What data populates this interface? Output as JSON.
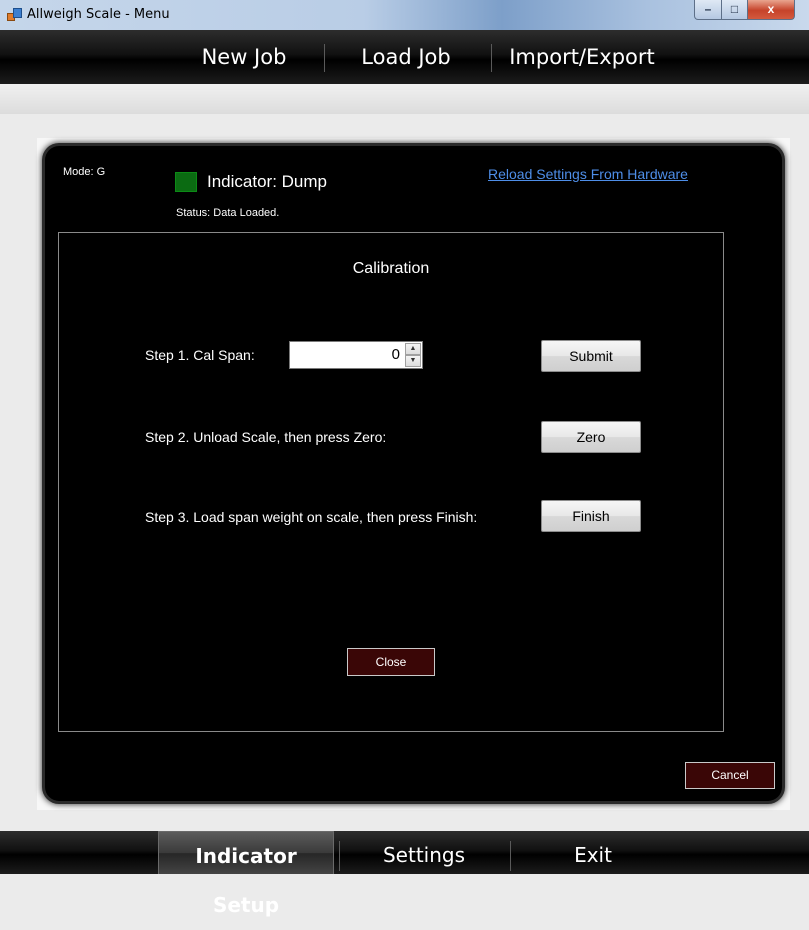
{
  "window": {
    "title": "Allweigh Scale - Menu",
    "controls": {
      "minimize": "–",
      "maximize": "□",
      "close": "x"
    }
  },
  "top_menu": {
    "items": [
      {
        "label": "New Job"
      },
      {
        "label": "Load Job"
      },
      {
        "label": "Import/Export"
      }
    ]
  },
  "header": {
    "mode": "Mode: G",
    "indicator_label": "Indicator: Dump",
    "indicator_color": "#0b6b12",
    "status": "Status: Data Loaded.",
    "reload_link": "Reload Settings From Hardware"
  },
  "calibration": {
    "title": "Calibration",
    "step1_label": "Step 1.  Cal Span:",
    "cal_span_value": "0",
    "submit_label": "Submit",
    "step2_label": "Step 2.  Unload Scale, then press Zero:",
    "zero_label": "Zero",
    "step3_label": "Step 3.  Load span weight on scale, then press Finish:",
    "finish_label": "Finish",
    "close_label": "Close"
  },
  "footer": {
    "cancel_label": "Cancel"
  },
  "bottom_menu": {
    "items": [
      {
        "label": "Indicator Setup",
        "active": true
      },
      {
        "label": "Settings",
        "active": false
      },
      {
        "label": "Exit",
        "active": false
      }
    ]
  }
}
